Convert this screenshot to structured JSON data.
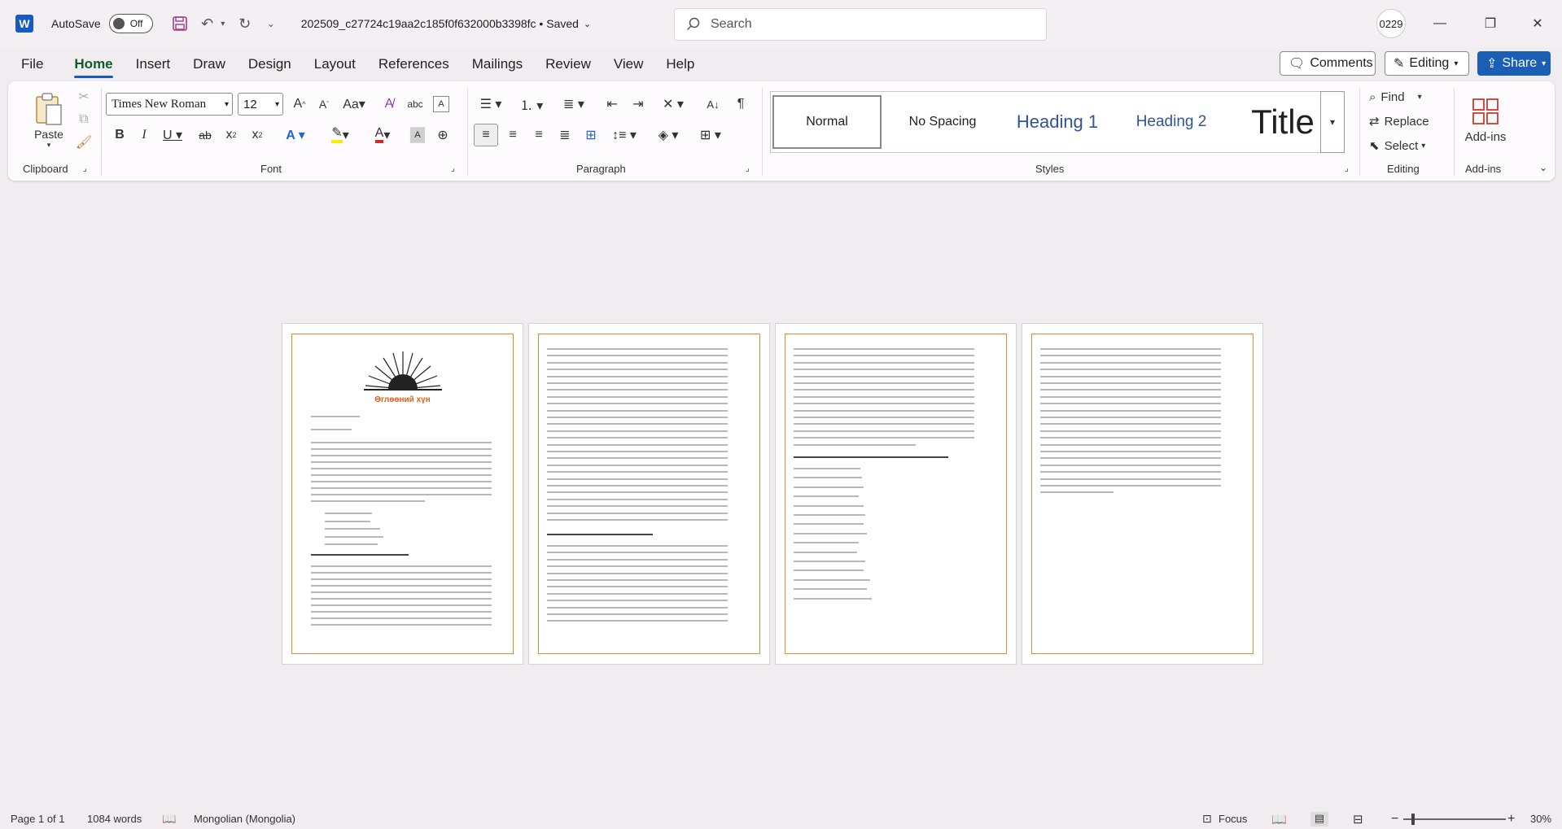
{
  "title_bar": {
    "app_logo": "W",
    "autosave_label": "AutoSave",
    "autosave_state": "Off",
    "document_title": "202509_c27724c19aa2c185f0f632000b3398fc  •  Saved",
    "search_placeholder": "Search",
    "user_initials": "0229"
  },
  "menu": {
    "tabs": [
      "File",
      "Home",
      "Insert",
      "Draw",
      "Design",
      "Layout",
      "References",
      "Mailings",
      "Review",
      "View",
      "Help"
    ],
    "active_tab": "Home",
    "comments_label": "Comments",
    "editing_label": "Editing",
    "share_label": "Share"
  },
  "ribbon": {
    "clipboard": {
      "paste_label": "Paste",
      "group_label": "Clipboard"
    },
    "font": {
      "font_name": "Times New Roman",
      "font_size": "12",
      "group_label": "Font"
    },
    "paragraph": {
      "group_label": "Paragraph"
    },
    "styles": {
      "items": [
        "Normal",
        "No Spacing",
        "Heading 1",
        "Heading 2",
        "Title"
      ],
      "group_label": "Styles"
    },
    "editing": {
      "find": "Find",
      "replace": "Replace",
      "select": "Select",
      "group_label": "Editing"
    },
    "addins": {
      "label": "Add-ins",
      "group_label": "Add-ins"
    }
  },
  "document": {
    "logo_caption": "Өглөөний хүн",
    "page2_heading": "Хоердугаар бүлэг: Өглөөний хүн алхмуудад оруулахаар",
    "page3_heading": "I хэвшлүүнгүр бүлэг: Хаан өглөөний хүн болох вэ? 100 өдрийн төлөвлөгөө"
  },
  "status_bar": {
    "page": "Page 1 of 1",
    "words": "1084 words",
    "language": "Mongolian (Mongolia)",
    "focus": "Focus",
    "zoom": "30%"
  },
  "colors": {
    "accent": "#185abd",
    "page_margin": "#e8892b",
    "logo_text": "#e85c1a"
  }
}
